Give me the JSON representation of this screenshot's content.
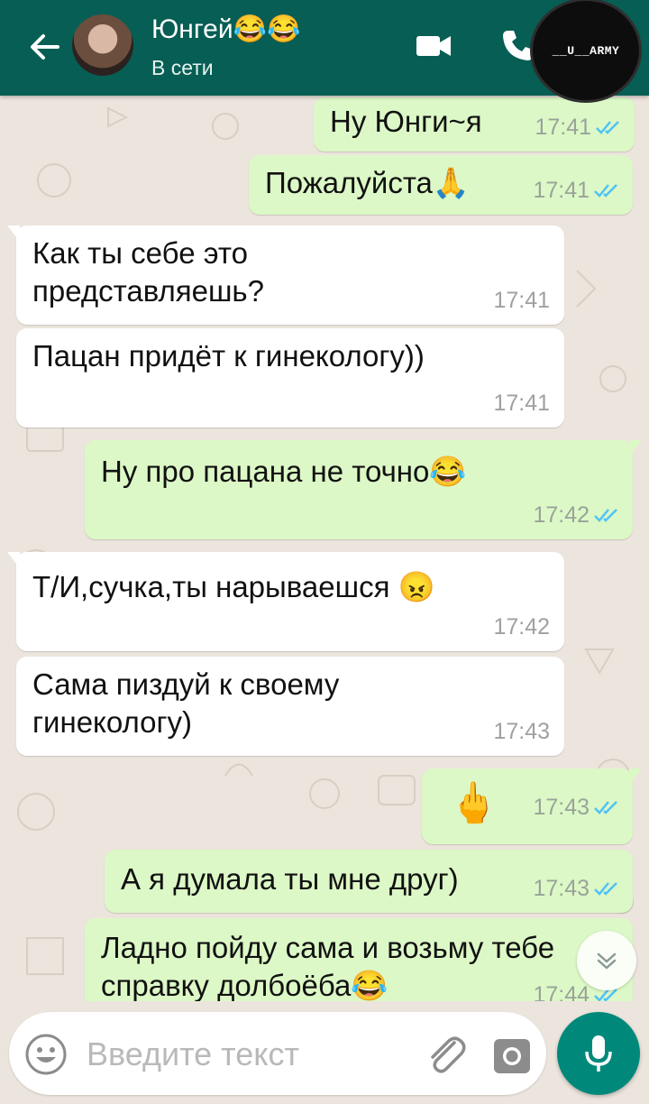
{
  "header": {
    "contact_name": "Юнгей😂😂",
    "status": "В сети",
    "watermark": "__U__ARMY"
  },
  "messages": [
    {
      "direction": "out",
      "text": "Ну Юнги~я",
      "time": "17:41",
      "read": true
    },
    {
      "direction": "out",
      "text": "Пожалуйста🙏",
      "time": "17:41",
      "read": true
    },
    {
      "direction": "in",
      "text": "Как ты себе это\nпредставляешь?",
      "time": "17:41"
    },
    {
      "direction": "in",
      "text": "Пацан придёт к гинекологу))",
      "time": "17:41"
    },
    {
      "direction": "out",
      "text": "Ну про пацана не точно😂",
      "time": "17:42",
      "read": true
    },
    {
      "direction": "in",
      "text": "Т/И,сучка,ты нарываешся 😠",
      "time": "17:42"
    },
    {
      "direction": "in",
      "text": "Сама пиздуй к своему\nгинекологу)",
      "time": "17:43"
    },
    {
      "direction": "out",
      "text": "🖕",
      "time": "17:43",
      "read": true
    },
    {
      "direction": "out",
      "text": "А я думала ты мне друг)",
      "time": "17:43",
      "read": true
    },
    {
      "direction": "out",
      "text": "Ладно пойду сама и возьму тебе\nсправку долбоёба😂",
      "time": "17:44",
      "read": true
    }
  ],
  "input": {
    "placeholder": "Введите текст"
  },
  "colors": {
    "header": "#075e54",
    "outgoing_bubble": "#dcf8c6",
    "incoming_bubble": "#ffffff",
    "read_tick": "#4fc3f7",
    "mic_button": "#00897b"
  },
  "icons": [
    "back-arrow-icon",
    "video-camera-icon",
    "phone-icon",
    "double-tick-icon",
    "chevron-down-icon",
    "emoji-icon",
    "paperclip-icon",
    "camera-icon",
    "microphone-icon"
  ]
}
